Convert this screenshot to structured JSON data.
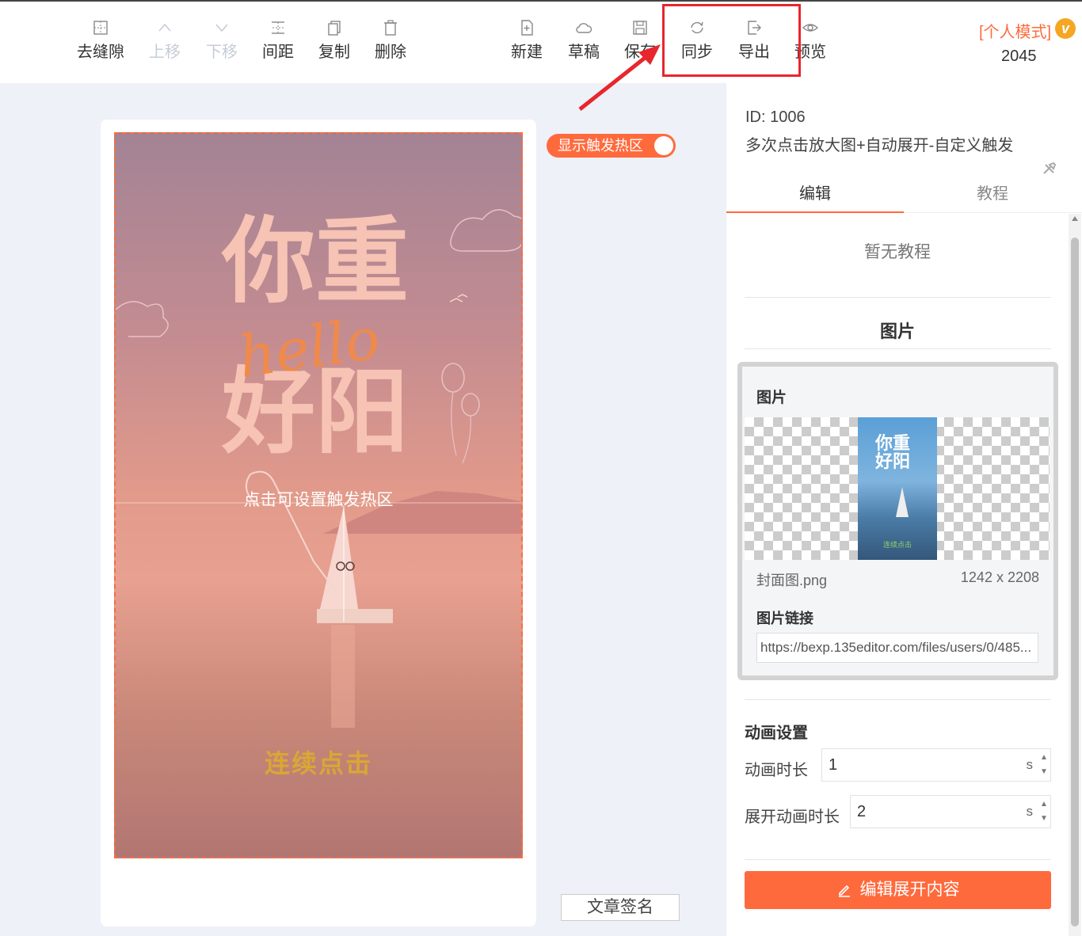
{
  "toolbar": {
    "items": [
      {
        "label": "去缝隙",
        "icon": "grid-gap-icon",
        "enabled": true
      },
      {
        "label": "上移",
        "icon": "chevron-up-icon",
        "enabled": false
      },
      {
        "label": "下移",
        "icon": "chevron-down-icon",
        "enabled": false
      },
      {
        "label": "间距",
        "icon": "spacing-icon",
        "enabled": true
      },
      {
        "label": "复制",
        "icon": "copy-icon",
        "enabled": true
      },
      {
        "label": "删除",
        "icon": "trash-icon",
        "enabled": true
      },
      {
        "label": "新建",
        "icon": "new-file-icon",
        "enabled": true
      },
      {
        "label": "草稿",
        "icon": "cloud-icon",
        "enabled": true
      },
      {
        "label": "保存",
        "icon": "save-icon",
        "enabled": true
      },
      {
        "label": "同步",
        "icon": "sync-icon",
        "enabled": true
      },
      {
        "label": "导出",
        "icon": "export-icon",
        "enabled": true
      },
      {
        "label": "预览",
        "icon": "eye-icon",
        "enabled": true
      }
    ],
    "mode_label": "[个人模式]",
    "vip_badge": "v",
    "count": "2045"
  },
  "canvas": {
    "poster_title_top": "你重",
    "poster_title_bottom": "好阳",
    "poster_hello": "hello",
    "hotspot_text": "点击可设置触发热区",
    "tap_text": "连续点击",
    "toggle_label": "显示触发热区",
    "signature_button": "文章签名"
  },
  "panel": {
    "id_line": "ID: 1006",
    "name": "多次点击放大图+自动展开-自定义触发",
    "tabs": [
      {
        "label": "编辑",
        "active": true
      },
      {
        "label": "教程",
        "active": false
      }
    ],
    "no_tutorial": "暂无教程",
    "image_section_title": "图片",
    "image_box": {
      "title": "图片",
      "thumb_text_top": "你重",
      "thumb_text_bottom": "好阳",
      "thumb_green": "连续点击",
      "file_name": "封面图.png",
      "file_size": "1242 x 2208",
      "link_label": "图片链接",
      "link_value": "https://bexp.135editor.com/files/users/0/485..."
    },
    "animation": {
      "title": "动画设置",
      "duration_label": "动画时长",
      "duration_value": "1",
      "duration_unit": "s",
      "expand_label": "展开动画时长",
      "expand_value": "2",
      "expand_unit": "s"
    },
    "edit_button": "编辑展开内容"
  },
  "colors": {
    "accent": "#ff6a3d",
    "annotation": "#e8262d"
  }
}
